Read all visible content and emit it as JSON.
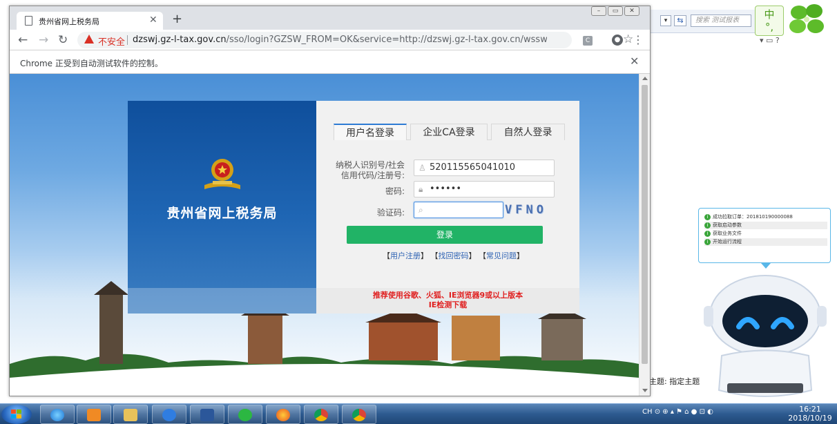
{
  "tab": {
    "title": "贵州省网上税务局"
  },
  "address": {
    "not_secure": "不安全",
    "url_host": "dzswj.gz-l-tax.gov.cn",
    "url_rest": "/sso/login?GZSW_FROM=OK&service=http://dzswj.gz-l-tax.gov.cn/wsswj/ind..."
  },
  "infobar": {
    "message": "Chrome 正受到自动测试软件的控制。"
  },
  "login": {
    "brand_title": "贵州省网上税务局",
    "tabs": [
      "用户名登录",
      "企业CA登录",
      "自然人登录"
    ],
    "taxpayer_label_line1": "纳税人识别号/社会",
    "taxpayer_label_line2": "信用代码/注册号:",
    "taxpayer_value": "520115565041010",
    "password_label": "密码:",
    "password_value": "••••••",
    "captcha_label": "验证码:",
    "captcha_value": "",
    "captcha_image_text": "VFNO",
    "login_button": "登录",
    "links": [
      "用户注册",
      "找回密码",
      "常见问题"
    ],
    "notice_line1": "推荐使用谷歌、火狐、IE浏览器9或以上版本",
    "notice_line2": "IE检测下载"
  },
  "background_app": {
    "search_placeholder": "搜索 测试报表",
    "ime_label": "中",
    "ime_punct": "°,",
    "topic_text": "主题: 指定主题"
  },
  "assistant": {
    "rows": [
      "成功拉取订单：201810190000088",
      "获取启动参数",
      "获取业务文件",
      "开始运行流程"
    ]
  },
  "taskbar": {
    "tray_lang": "CH",
    "time": "16:21",
    "date": "2018/10/19"
  },
  "colors": {
    "login_green": "#21b366",
    "notice_red": "#e02020",
    "brand_blue": "#0f4f9c",
    "warning_red": "#d93025"
  }
}
